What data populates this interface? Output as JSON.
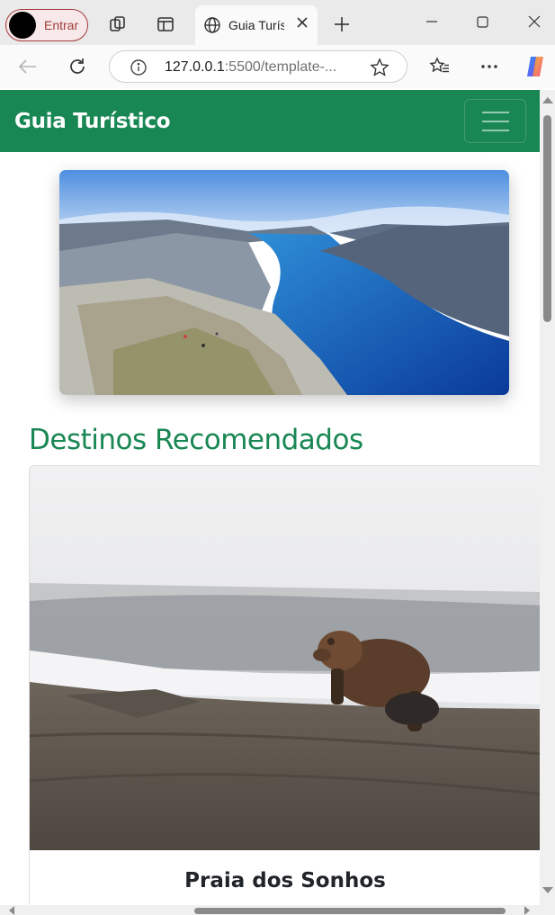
{
  "browser": {
    "profile_label": "Entrar",
    "tab_title": "Guia Turístico",
    "url_host": "127.0.0.1",
    "url_rest": ":5500/template-...",
    "icons": [
      "back-arrow-icon",
      "reload-icon",
      "info-icon",
      "star-icon",
      "favorites-icon",
      "more-icon",
      "copilot-icon"
    ]
  },
  "navbar": {
    "brand": "Guia Turístico",
    "color": "#198754"
  },
  "main": {
    "section_title": "Destinos Recomendados",
    "cards": [
      {
        "title": "Praia dos Sonhos"
      }
    ]
  }
}
